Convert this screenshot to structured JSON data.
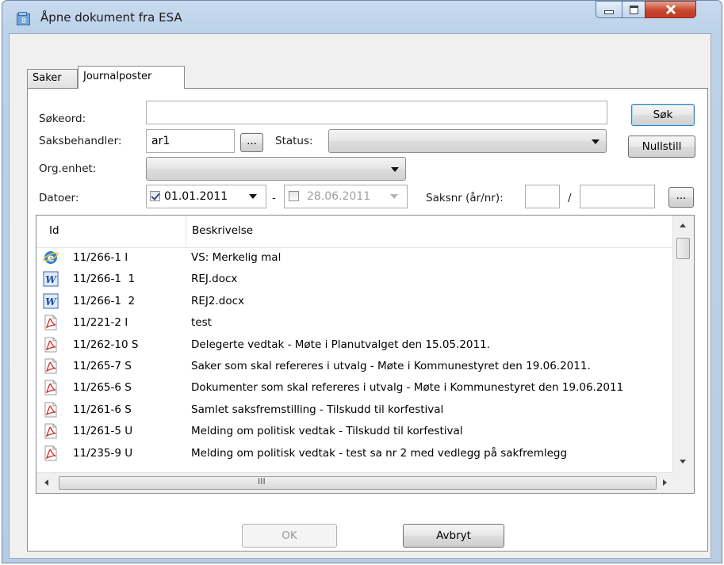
{
  "window": {
    "title": "Åpne dokument fra ESA",
    "controls": {
      "minimize": "minimize-icon",
      "maximize": "maximize-icon",
      "close": "close-icon"
    }
  },
  "tabs": [
    {
      "label": "Saker",
      "active": false
    },
    {
      "label": "Journalposter",
      "active": true
    }
  ],
  "form": {
    "sokeord_label": "Søkeord:",
    "sokeord_value": "",
    "saksbehandler_label": "Saksbehandler:",
    "saksbehandler_value": "ar1",
    "browse_label": "...",
    "status_label": "Status:",
    "status_value": "",
    "orgenhet_label": "Org.enhet:",
    "orgenhet_value": "",
    "datoer_label": "Datoer:",
    "date_from": "01.01.2011",
    "date_from_checked": true,
    "date_separator": "-",
    "date_to": "28.06.2011",
    "date_to_checked": false,
    "saksnr_label": "Saksnr (år/nr):",
    "saksnr_year": "",
    "saksnr_slash": "/",
    "saksnr_nr": "",
    "saksnr_browse_label": "...",
    "search_button": "Søk",
    "reset_button": "Nullstill"
  },
  "list": {
    "columns": [
      "Id",
      "Beskrivelse"
    ],
    "rows": [
      {
        "icon": "ie-icon",
        "id": "11/266-1 I",
        "desc": "VS: Merkelig mal"
      },
      {
        "icon": "word-icon",
        "id": "11/266-1  1",
        "desc": "REJ.docx"
      },
      {
        "icon": "word-icon",
        "id": "11/266-1  2",
        "desc": "REJ2.docx"
      },
      {
        "icon": "pdf-icon",
        "id": "11/221-2 I",
        "desc": "test"
      },
      {
        "icon": "pdf-icon",
        "id": "11/262-10 S",
        "desc": "Delegerte vedtak - Møte i Planutvalget den 15.05.2011."
      },
      {
        "icon": "pdf-icon",
        "id": "11/265-7 S",
        "desc": "Saker som skal refereres i utvalg - Møte i Kommunestyret den 19.06.2011."
      },
      {
        "icon": "pdf-icon",
        "id": "11/265-6 S",
        "desc": "Dokumenter som skal refereres i utvalg - Møte i Kommunestyret den 19.06.2011"
      },
      {
        "icon": "pdf-icon",
        "id": "11/261-6 S",
        "desc": "Samlet saksfremstilling - Tilskudd til korfestival"
      },
      {
        "icon": "pdf-icon",
        "id": "11/261-5 U",
        "desc": "Melding om politisk vedtak - Tilskudd til korfestival"
      },
      {
        "icon": "pdf-icon",
        "id": "11/235-9 U",
        "desc": "Melding om politisk vedtak - test sa nr 2 med vedlegg på sakfremlegg"
      }
    ],
    "hscroll_grip": "III"
  },
  "footer": {
    "ok_button": "OK",
    "cancel_button": "Avbryt"
  },
  "colors": {
    "accent": "#3c7fb1",
    "close": "#c7462e",
    "frame": "#b7cde6"
  }
}
